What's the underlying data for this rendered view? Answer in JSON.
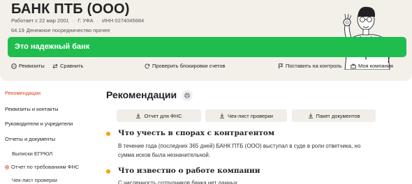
{
  "company": {
    "name": "БАНК ПТБ (ООО)",
    "meta": {
      "works_since": "Работает с 22 мар 2001",
      "city": "Г. УФА",
      "inn": "ИНН 0274045684"
    },
    "okved_code": "64.19",
    "okved_text": "Денежное посредничество прочее"
  },
  "banner": {
    "text": "Это надежный банк",
    "color": "#1fbd4e"
  },
  "toolbar": {
    "requisites": "Реквизиты",
    "compare": "Сравнить",
    "check_blocks": "Проверить блокировки счетов",
    "monitor": "Поставить на контроль",
    "my_company": "Моя компания"
  },
  "sidebar": {
    "items": [
      {
        "label": "Рекомендации",
        "active": true
      },
      {
        "label": "Реквизиты и контакты"
      },
      {
        "label": "Руководители и учредители"
      },
      {
        "label": "Отчеты и документы"
      },
      {
        "label": "Выписки ЕГРЮЛ"
      },
      {
        "label": "Отчет по требованиям ФНС"
      },
      {
        "label": "Чек-лист проверки"
      }
    ]
  },
  "main": {
    "title": "Рекомендации",
    "buttons": {
      "fns_report": "Отчет для ФНС",
      "checklist": "Чек-лист проверки",
      "documents": "Пакет документов"
    },
    "sections": [
      {
        "title": "Что учесть в спорах с контрагентом",
        "text": "В течение года (последних 365 дней) БАНК ПТБ (ООО) выступал в суде в роли ответчика, но сумма исков была незначительной."
      },
      {
        "title": "Что известно о работе компании",
        "text": "С численность сотрудников банка нет данных"
      }
    ]
  },
  "colors": {
    "accent_orange": "#e0401a",
    "bullet": "#f5a300",
    "header_bg": "#f3efe9"
  }
}
